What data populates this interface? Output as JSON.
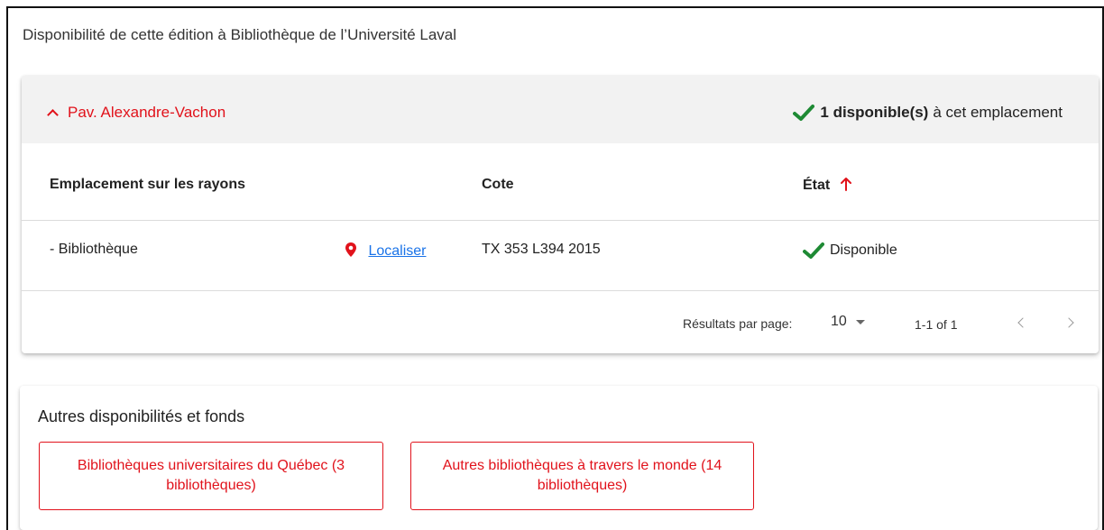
{
  "page_heading": "Disponibilité de cette édition à Bibliothèque de l’Université Laval",
  "location": {
    "name": "Pav. Alexandre-Vachon",
    "available_count_label": "1 disponible(s)",
    "available_suffix": "à cet emplacement"
  },
  "table": {
    "headers": {
      "shelf": "Emplacement sur les rayons",
      "call_number": "Cote",
      "status": "État"
    },
    "rows": [
      {
        "shelf": "- Bibliothèque",
        "locate_link": "Localiser",
        "call_number": "TX 353 L394 2015",
        "status": "Disponible"
      }
    ]
  },
  "pagination": {
    "per_page_label": "Résultats par page:",
    "per_page_value": "10",
    "range": "1-1 of 1"
  },
  "other_holdings": {
    "title": "Autres disponibilités et fonds",
    "buttons": [
      "Bibliothèques universitaires du Québec (3 bibliothèques)",
      "Autres bibliothèques à travers le monde (14 bibliothèques)"
    ]
  },
  "colors": {
    "accent_red": "#e1121b",
    "available_green": "#1e8a34",
    "link_blue": "#1a73e8"
  },
  "icons": [
    "chevron-up-icon",
    "check-icon",
    "arrow-up-icon",
    "map-pin-icon",
    "caret-down-icon",
    "chevron-left-icon",
    "chevron-right-icon"
  ]
}
